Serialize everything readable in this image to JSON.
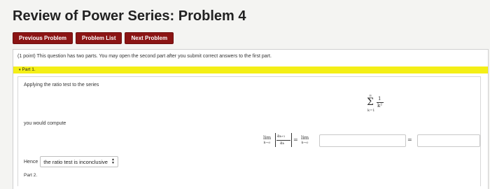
{
  "title": "Review of Power Series: Problem 4",
  "nav": {
    "prev": "Previous Problem",
    "list": "Problem List",
    "next": "Next Problem"
  },
  "intro": "(1 point) This question has two parts. You may open the second part after you submit correct answers to the first part.",
  "part1": {
    "label": "Part 1.",
    "applying": "Applying the ratio test to the series",
    "series": {
      "sigma": "Σ",
      "upper": "∞",
      "lower": "k=1",
      "numerator": "1",
      "denominator": "k²"
    },
    "compute_text": "you would compute",
    "math": {
      "lim": "lim",
      "lim_sub": "k→∞",
      "frac_num": "aₖ₊₁",
      "frac_den": "aₖ",
      "equals": "="
    },
    "answer1_value": "",
    "answer2_value": "",
    "hence": "Hence",
    "select_value": "the ratio test is inconclusive"
  },
  "part2": {
    "label": "Part 2."
  },
  "colors": {
    "nav_button": "#8b1414",
    "part_bar": "#f4ef16"
  },
  "icons": {
    "part_toggle": "caret-down-icon",
    "select": "up-down-arrows-icon"
  }
}
